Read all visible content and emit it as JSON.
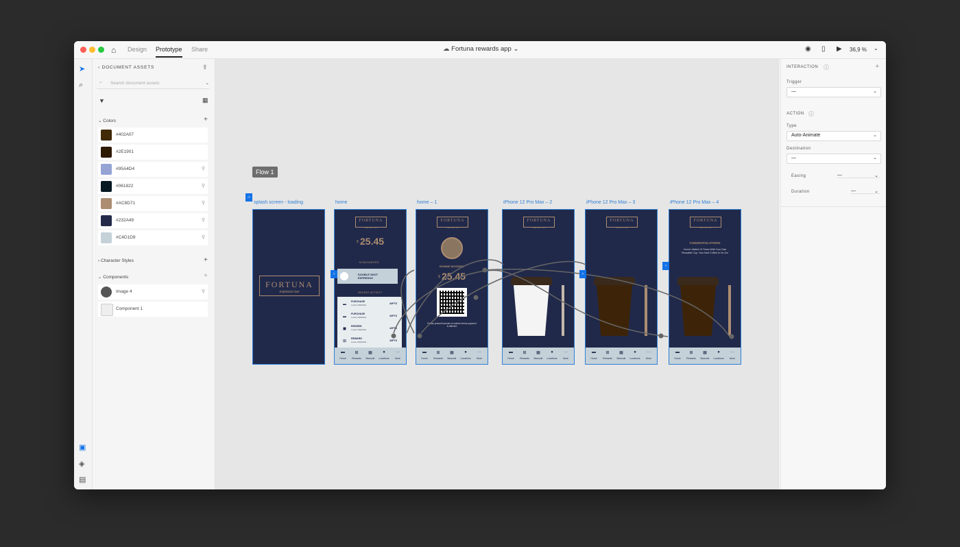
{
  "titlebar": {
    "modes": [
      "Design",
      "Prototype",
      "Share"
    ],
    "document_title": "Fortuna rewards app",
    "zoom": "36,9 %"
  },
  "assets": {
    "header": "DOCUMENT ASSETS",
    "search_placeholder": "Search document assets",
    "colors_label": "Colors",
    "colors": [
      {
        "hex": "#402A07",
        "label": "#402A07"
      },
      {
        "hex": "#2E1901",
        "label": "#2E1901"
      },
      {
        "hex": "#95A4D4",
        "label": "#95A4D4"
      },
      {
        "hex": "#061822",
        "label": "#061822"
      },
      {
        "hex": "#AC8D71",
        "label": "#AC8D71"
      },
      {
        "hex": "#232A49",
        "label": "#232A49"
      },
      {
        "hex": "#C4D1D9",
        "label": "#C4D1D9"
      }
    ],
    "char_styles_label": "Character Styles",
    "components_label": "Components",
    "components": [
      "Image 4",
      "Component 1"
    ]
  },
  "canvas": {
    "flow_label": "Flow 1",
    "artboards": [
      "splash screen - loading",
      "home",
      "home – 1",
      "iPhone 12 Pro Max – 2",
      "iPhone 12 Pro Max – 3",
      "iPhone 12 Pro Max – 4"
    ],
    "app": {
      "logo": "FORTUNA",
      "logo_sub": "espresso bar",
      "balance": "25.45",
      "currency": "$",
      "favourites": "FAVOURITES",
      "favourite_item": "DOUBLE SHOT ESPRESSO",
      "recent_activity": "RECENT ACTIVITY",
      "activity": [
        {
          "title": "PURCHASE",
          "sub": "London 28/09/2021",
          "pts": "40PTS"
        },
        {
          "title": "PURCHASE",
          "sub": "London 28/09/2021",
          "pts": "40PTS"
        },
        {
          "title": "REDEEM",
          "sub": "London 28/09/2021",
          "pts": "40PTS"
        },
        {
          "title": "REWARD",
          "sub": "London 28/09/2021",
          "pts": "40PTS"
        }
      ],
      "user_name": "RONNIE WOODRIN",
      "barcode_note": "Please present barcode to cashier before payment is affected",
      "congrats_title": "CONGRATULATIONS",
      "congrats_text": "You've Visited 10 Times With Your Own Reusable Cup. Your Next Coffee Is On Us!",
      "nav": [
        "Home",
        "Rewards",
        "Barcode",
        "Locations",
        "More"
      ]
    }
  },
  "interaction": {
    "header": "INTERACTION",
    "trigger_label": "Trigger",
    "trigger_value": "—",
    "action_header": "ACTION",
    "type_label": "Type",
    "type_value": "Auto-Animate",
    "destination_label": "Destination",
    "destination_value": "—",
    "easing_label": "Easing",
    "easing_value": "—",
    "duration_label": "Duration",
    "duration_value": "—"
  },
  "colors": {
    "accent": "#1473e6",
    "artboard_bg": "#21294a",
    "gold": "#ac8d71",
    "nav_bg": "#c4d1d9"
  }
}
